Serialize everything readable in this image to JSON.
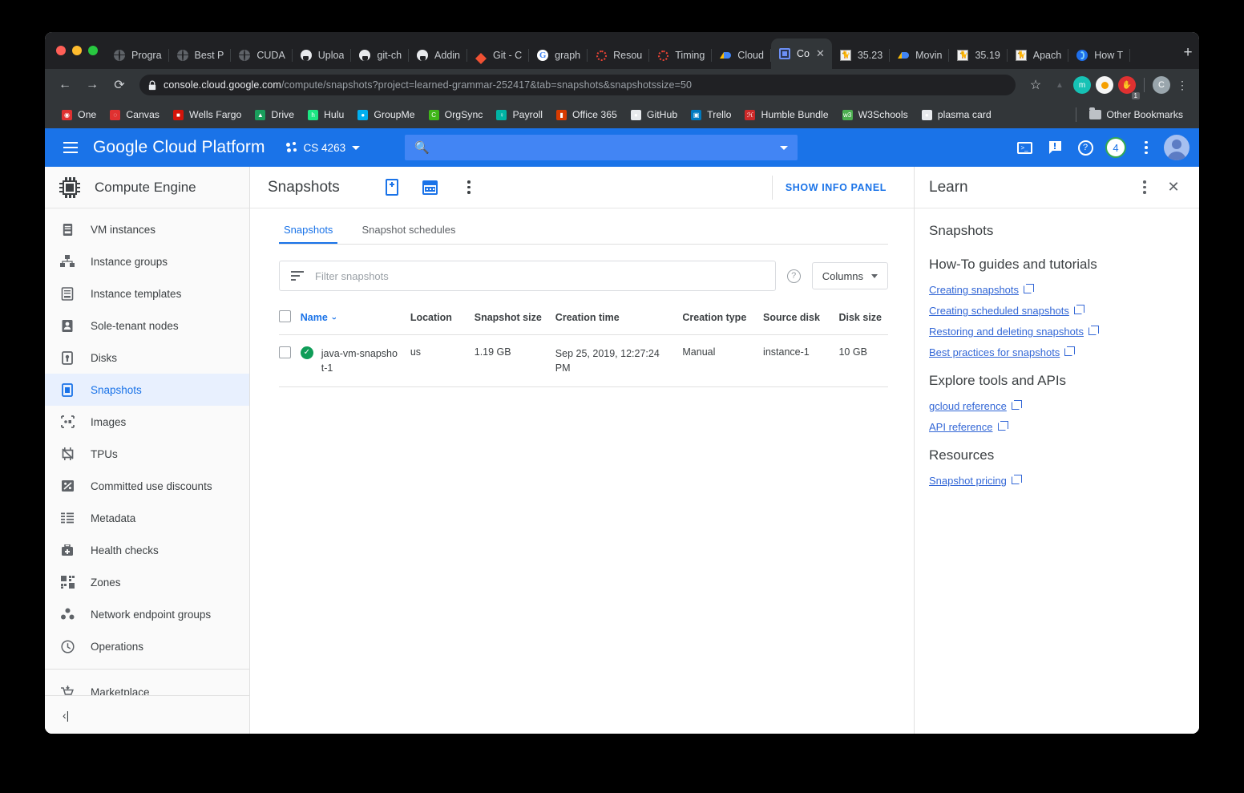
{
  "browser": {
    "tabs": [
      {
        "label": "Progra",
        "favicon": "globe-icon",
        "active": false
      },
      {
        "label": "Best P",
        "favicon": "globe-icon",
        "active": false
      },
      {
        "label": "CUDA",
        "favicon": "globe-icon",
        "active": false
      },
      {
        "label": "Uploa",
        "favicon": "github-icon",
        "active": false
      },
      {
        "label": "git-ch",
        "favicon": "github-icon",
        "active": false
      },
      {
        "label": "Addin",
        "favicon": "github-icon",
        "active": false
      },
      {
        "label": "Git - C",
        "favicon": "git-icon",
        "active": false
      },
      {
        "label": "graph",
        "favicon": "google-icon",
        "active": false
      },
      {
        "label": "Resou",
        "favicon": "red-ring-icon",
        "active": false
      },
      {
        "label": "Timing",
        "favicon": "red-ring-icon",
        "active": false
      },
      {
        "label": "Cloud",
        "favicon": "gcp-icon",
        "active": false
      },
      {
        "label": "Co",
        "favicon": "compute-chip-icon",
        "active": true
      },
      {
        "label": "35.23",
        "favicon": "tomcat-icon",
        "active": false
      },
      {
        "label": "Movin",
        "favicon": "gcp-icon",
        "active": false
      },
      {
        "label": "35.19",
        "favicon": "tomcat-icon",
        "active": false
      },
      {
        "label": "Apach",
        "favicon": "tomcat-icon",
        "active": false
      },
      {
        "label": "How T",
        "favicon": "firefox-blue-icon",
        "active": false
      }
    ],
    "new_tab_label": "+",
    "close_label": "✕",
    "nav": {
      "back": "←",
      "forward": "→",
      "reload": "⟳"
    },
    "url": {
      "domain": "console.cloud.google.com",
      "path": "/compute/snapshots?project=learned-grammar-252417&tab=snapshots&snapshotssize=50"
    },
    "omnibox_actions": {
      "bookmark": "☆",
      "extensions": [
        {
          "name": "drive-extension-icon",
          "glyph": "▲",
          "color": "#5f6368",
          "bg": "transparent"
        },
        {
          "name": "mercury-extension-icon",
          "glyph": "m",
          "color": "#ffffff",
          "bg": "#16c2b5"
        },
        {
          "name": "honey-extension-icon",
          "glyph": "",
          "color": "#ffffff",
          "bg": "#f5f5f5"
        },
        {
          "name": "stop-extension-icon",
          "glyph": "✋",
          "color": "#ffffff",
          "bg": "#e03131"
        }
      ],
      "extension_badge": "1",
      "profile_initial": "C",
      "menu": "⋮"
    },
    "bookmarks": [
      {
        "label": "One",
        "icon": "onenote-icon",
        "color": "#e03131",
        "glyph": "◉"
      },
      {
        "label": "Canvas",
        "icon": "canvas-icon",
        "color": "#e03131",
        "glyph": "◌"
      },
      {
        "label": "Wells Fargo",
        "icon": "wells-fargo-icon",
        "color": "#d4140a",
        "glyph": "■"
      },
      {
        "label": "Drive",
        "icon": "google-drive-icon",
        "color": "#1a9e5c",
        "glyph": "▲"
      },
      {
        "label": "Hulu",
        "icon": "hulu-icon",
        "color": "#1ce783",
        "glyph": "h"
      },
      {
        "label": "GroupMe",
        "icon": "groupme-icon",
        "color": "#00aff0",
        "glyph": "●"
      },
      {
        "label": "OrgSync",
        "icon": "orgsync-icon",
        "color": "#3fb618",
        "glyph": "C"
      },
      {
        "label": "Payroll",
        "icon": "payroll-icon",
        "color": "#00b3a4",
        "glyph": "♀"
      },
      {
        "label": "Office 365",
        "icon": "office365-icon",
        "color": "#d83b01",
        "glyph": "▮"
      },
      {
        "label": "GitHub",
        "icon": "github-icon",
        "color": "#e8eaed",
        "glyph": "●"
      },
      {
        "label": "Trello",
        "icon": "trello-icon",
        "color": "#0079bf",
        "glyph": "▣"
      },
      {
        "label": "Humble Bundle",
        "icon": "humble-bundle-icon",
        "color": "#cc2929",
        "glyph": "ℋ"
      },
      {
        "label": "W3Schools",
        "icon": "w3schools-icon",
        "color": "#4caf50",
        "glyph": "w3"
      },
      {
        "label": "plasma card",
        "icon": "globe-icon",
        "color": "#e8eaed",
        "glyph": "●"
      }
    ],
    "other_bookmarks_label": "Other Bookmarks"
  },
  "gcp_header": {
    "hamburger_name": "navigation-menu",
    "product_brand": "Google Cloud Platform",
    "project_name": "CS 4263",
    "search_placeholder": "",
    "search_icon": "search-icon",
    "actions": [
      {
        "name": "cloud-shell-icon",
        "glyph": ">_"
      },
      {
        "name": "feedback-icon",
        "glyph": "!"
      },
      {
        "name": "help-icon",
        "glyph": "?"
      },
      {
        "name": "notifications-badge",
        "glyph": "4"
      },
      {
        "name": "more-options-icon",
        "glyph": "⋮"
      },
      {
        "name": "account-avatar",
        "glyph": ""
      }
    ],
    "notification_count": "4"
  },
  "sidebar": {
    "product_title": "Compute Engine",
    "product_icon": "cpu-chip-icon",
    "items": [
      {
        "label": "VM instances",
        "icon": "vm-instances-icon",
        "active": false
      },
      {
        "label": "Instance groups",
        "icon": "instance-groups-icon",
        "active": false
      },
      {
        "label": "Instance templates",
        "icon": "instance-templates-icon",
        "active": false
      },
      {
        "label": "Sole-tenant nodes",
        "icon": "sole-tenant-nodes-icon",
        "active": false
      },
      {
        "label": "Disks",
        "icon": "disks-icon",
        "active": false
      },
      {
        "label": "Snapshots",
        "icon": "snapshots-icon",
        "active": true
      },
      {
        "label": "Images",
        "icon": "images-icon",
        "active": false
      },
      {
        "label": "TPUs",
        "icon": "tpus-icon",
        "active": false
      },
      {
        "label": "Committed use discounts",
        "icon": "percent-icon",
        "active": false
      },
      {
        "label": "Metadata",
        "icon": "metadata-icon",
        "active": false
      },
      {
        "label": "Health checks",
        "icon": "health-checks-icon",
        "active": false
      },
      {
        "label": "Zones",
        "icon": "zones-icon",
        "active": false
      },
      {
        "label": "Network endpoint groups",
        "icon": "network-endpoint-groups-icon",
        "active": false
      },
      {
        "label": "Operations",
        "icon": "operations-clock-icon",
        "active": false
      }
    ],
    "marketplace": {
      "label": "Marketplace",
      "icon": "marketplace-cart-icon"
    },
    "collapse_label": "‹|"
  },
  "main": {
    "page_title": "Snapshots",
    "header_actions": [
      {
        "name": "create-snapshot-button"
      },
      {
        "name": "create-snapshot-schedule-button"
      },
      {
        "name": "more-actions-button"
      }
    ],
    "show_info_panel_label": "SHOW INFO PANEL",
    "tabs": [
      {
        "label": "Snapshots",
        "active": true
      },
      {
        "label": "Snapshot schedules",
        "active": false
      }
    ],
    "filter": {
      "placeholder": "Filter snapshots",
      "value": "",
      "icon": "filter-icon",
      "help_icon": "help-circle-icon"
    },
    "columns_button_label": "Columns",
    "table": {
      "headers": [
        "Name",
        "Location",
        "Snapshot size",
        "Creation time",
        "Creation type",
        "Source disk",
        "Disk size"
      ],
      "sorted_column": "Name",
      "sort_direction": "asc",
      "rows": [
        {
          "status": "ready",
          "status_glyph": "✓",
          "name": "java-vm-snapshot-1",
          "location": "us",
          "snapshot_size": "1.19 GB",
          "creation_time": "Sep 25, 2019, 12:27:24 PM",
          "creation_type": "Manual",
          "source_disk": "instance-1",
          "disk_size": "10 GB"
        }
      ]
    }
  },
  "learn_panel": {
    "title": "Learn",
    "more_icon": "⋮",
    "close_icon": "✕",
    "heading": "Snapshots",
    "sections": [
      {
        "heading": "How-To guides and tutorials",
        "links": [
          "Creating snapshots",
          "Creating scheduled snapshots",
          "Restoring and deleting snapshots",
          "Best practices for snapshots"
        ]
      },
      {
        "heading": "Explore tools and APIs",
        "links": [
          "gcloud reference",
          "API reference"
        ]
      },
      {
        "heading": "Resources",
        "links": [
          "Snapshot pricing"
        ]
      }
    ]
  },
  "colors": {
    "gcp_blue": "#1a73e8",
    "chrome_dark": "#202124",
    "chrome_toolbar": "#323639",
    "active_nav_bg": "#e8f0fe",
    "status_green": "#0f9d58",
    "link_blue": "#3367d6"
  }
}
